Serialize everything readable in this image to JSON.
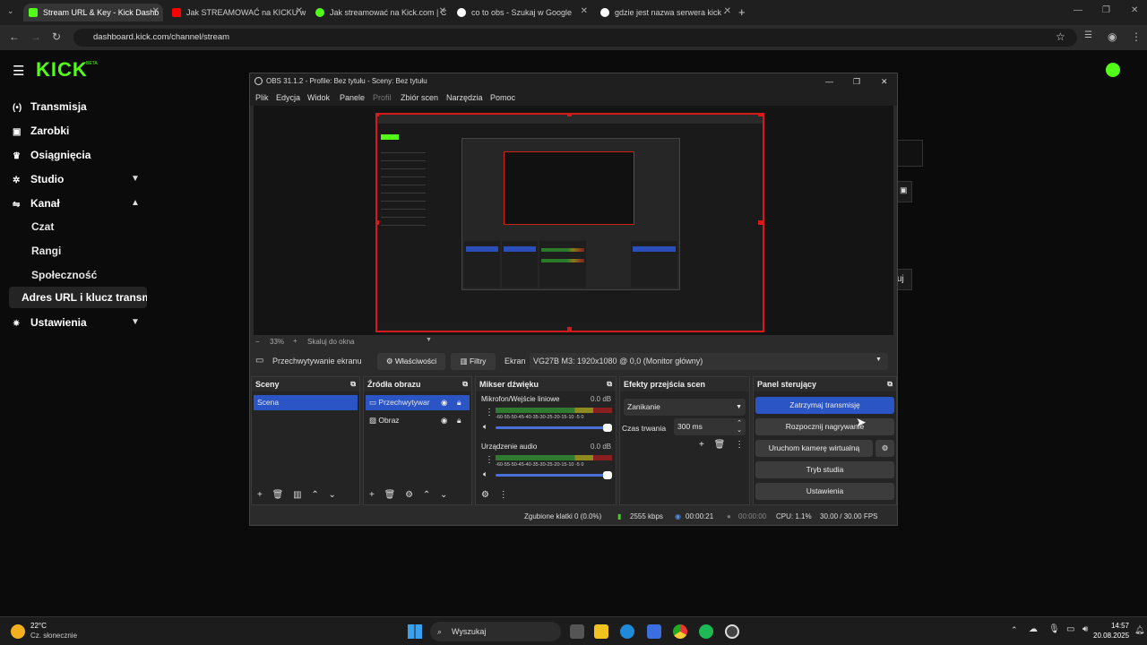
{
  "browser": {
    "tabs": [
      {
        "label": "Stream URL & Key - Kick Dashb",
        "color": "#53fc18"
      },
      {
        "label": "Jak STREAMOWAĆ na KICKU w",
        "color": "#ff0000"
      },
      {
        "label": "Jak streamować na Kick.com | C",
        "color": "#53fc18"
      },
      {
        "label": "co to obs - Szukaj w Google",
        "color": "#ffffff"
      },
      {
        "label": "gdzie jest nazwa serwera kick -",
        "color": "#ffffff"
      }
    ],
    "url": "dashboard.kick.com/channel/stream"
  },
  "kick": {
    "logo": "KICK",
    "logo_badge": "BETA",
    "sidebar": [
      {
        "label": "Transmisja",
        "icon": "broadcast-icon"
      },
      {
        "label": "Zarobki",
        "icon": "wallet-icon"
      },
      {
        "label": "Osiągnięcia",
        "icon": "trophy-icon"
      },
      {
        "label": "Studio",
        "icon": "studio-icon"
      },
      {
        "label": "Kanał",
        "icon": "channel-icon"
      }
    ],
    "channel_sub": [
      "Czat",
      "Rangi",
      "Społeczność",
      "Adres URL i klucz transmisji"
    ],
    "settings": "Ustawienia",
    "right_stub": "uj"
  },
  "obs": {
    "title": "OBS 31.1.2 - Profile: Bez tytułu - Sceny: Bez tytułu",
    "menu": [
      "Plik",
      "Edycja",
      "Widok",
      "Panele",
      "Profil",
      "Zbiór scen",
      "Narzędzia",
      "Pomoc"
    ],
    "zoom": "33%",
    "scale_label": "Skaluj do okna",
    "source_bar": {
      "source": "Przechwytywanie ekranu",
      "properties": "Właściwości",
      "filters": "Filtry",
      "screen_label": "Ekran",
      "screen_value": "VG27B M3: 1920x1080 @ 0,0 (Monitor główny)"
    },
    "scenes": {
      "title": "Sceny",
      "items": [
        "Scena"
      ]
    },
    "sources": {
      "title": "Źródła obrazu",
      "items": [
        "Przechwytywar",
        "Obraz"
      ]
    },
    "mixer": {
      "title": "Mikser dźwięku",
      "channels": [
        {
          "name": "Mikrofon/Wejście liniowe",
          "db": "0.0 dB"
        },
        {
          "name": "Urządzenie audio",
          "db": "0.0 dB"
        }
      ],
      "scale": "-60-55-50-45-40-35-30-25-20-15-10 -5 0"
    },
    "transitions": {
      "title": "Efekty przejścia scen",
      "type": "Zanikanie",
      "duration_label": "Czas trwania",
      "duration": "300 ms"
    },
    "controls": {
      "title": "Panel sterujący",
      "stop_stream": "Zatrzymaj transmisję",
      "start_rec": "Rozpocznij nagrywanie",
      "virtual_cam": "Uruchom kamerę wirtualną",
      "studio": "Tryb studia",
      "settings": "Ustawienia"
    },
    "status": {
      "dropped": "Zgubione klatki 0 (0.0%)",
      "bitrate": "2555 kbps",
      "stream_time": "00:00:21",
      "rec_time": "00:00:00",
      "cpu": "CPU: 1.1%",
      "fps": "30.00 / 30.00 FPS"
    }
  },
  "taskbar": {
    "weather_temp": "22°C",
    "weather_desc": "Cz. słonecznie",
    "search": "Wyszukaj",
    "time": "14:57",
    "date": "20.08.2025"
  }
}
